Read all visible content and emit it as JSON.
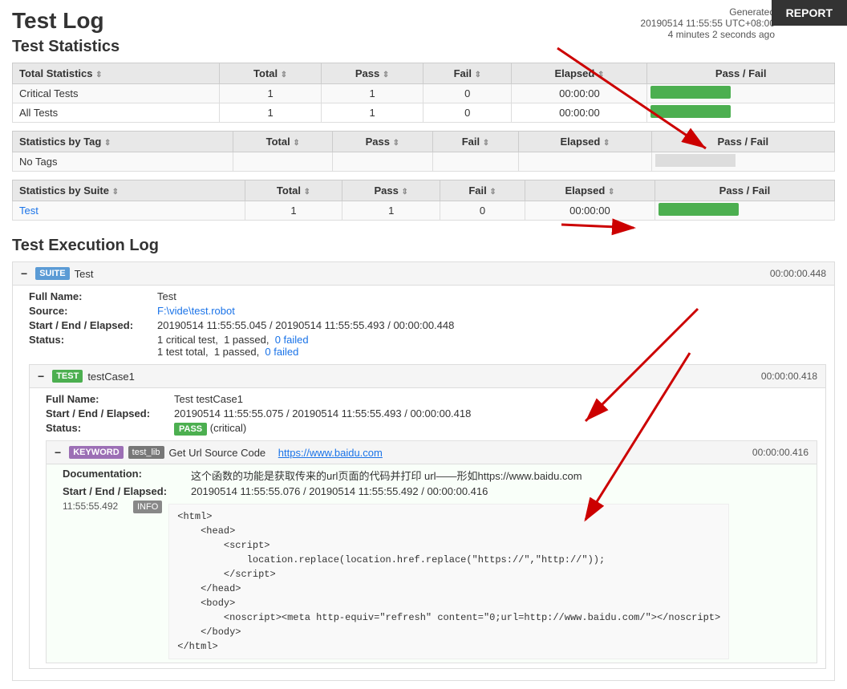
{
  "report_button": "REPORT",
  "page_title": "Test Log",
  "generated": {
    "label": "Generated",
    "datetime": "20190514 11:55:55 UTC+08:00",
    "ago": "4 minutes 2 seconds ago"
  },
  "test_statistics": {
    "heading": "Test Statistics",
    "total_stats": {
      "columns": [
        "Total Statistics",
        "Total",
        "Pass",
        "Fail",
        "Elapsed",
        "Pass / Fail"
      ],
      "rows": [
        {
          "name": "Critical Tests",
          "total": 1,
          "pass": 1,
          "fail": 0,
          "elapsed": "00:00:00",
          "pass_pct": 100
        },
        {
          "name": "All Tests",
          "total": 1,
          "pass": 1,
          "fail": 0,
          "elapsed": "00:00:00",
          "pass_pct": 100
        }
      ]
    },
    "tag_stats": {
      "columns": [
        "Statistics by Tag",
        "Total",
        "Pass",
        "Fail",
        "Elapsed",
        "Pass / Fail"
      ],
      "rows": [
        {
          "name": "No Tags",
          "total": "",
          "pass": "",
          "fail": "",
          "elapsed": "",
          "pass_pct": null
        }
      ]
    },
    "suite_stats": {
      "columns": [
        "Statistics by Suite",
        "Total",
        "Pass",
        "Fail",
        "Elapsed",
        "Pass / Fail"
      ],
      "rows": [
        {
          "name": "Test",
          "total": 1,
          "pass": 1,
          "fail": 0,
          "elapsed": "00:00:00",
          "pass_pct": 100
        }
      ]
    }
  },
  "execution_log": {
    "heading": "Test Execution Log",
    "suite": {
      "collapse": "−",
      "badge": "SUITE",
      "name": "Test",
      "elapsed": "00:00:00.448",
      "full_name_label": "Full Name:",
      "full_name": "Test",
      "source_label": "Source:",
      "source_path": "F:\\vide\\test.robot",
      "start_end_elapsed_label": "Start / End / Elapsed:",
      "start_end_elapsed": "20190514 11:55:55.045 / 20190514 11:55:55.493 / 00:00:00.448",
      "status_label": "Status:",
      "status_line1": "1 critical test,  1 passed,  0 failed",
      "status_line2": "1 test total,  1 passed,  0 failed",
      "test": {
        "collapse": "−",
        "badge": "TEST",
        "name": "testCase1",
        "elapsed": "00:00:00.418",
        "full_name_label": "Full Name:",
        "full_name": "Test testCase1",
        "start_end_elapsed_label": "Start / End / Elapsed:",
        "start_end_elapsed": "20190514 11:55:55.075 / 20190514 11:55:55.493 / 00:00:00.418",
        "status_label": "Status:",
        "status_badge": "PASS",
        "status_extra": "(critical)",
        "keyword": {
          "collapse": "−",
          "badge": "KEYWORD",
          "lib_badge": "test_lib",
          "name": "Get Url Source Code",
          "url": "https://www.baidu.com",
          "elapsed": "00:00:00.416",
          "doc_label": "Documentation:",
          "doc_text": "这个函数的功能是获取传来的url页面的代码并打印 url——形如https://www.baidu.com",
          "start_end_elapsed_label": "Start / End / Elapsed:",
          "start_end_elapsed": "20190514 11:55:55.076 / 20190514 11:55:55.492 / 00:00:00.416",
          "log_timestamp": "11:55:55.492",
          "log_badge": "INFO",
          "log_code": "<html>\n    <head>\n        <script>\n            location.replace(location.href.replace(\"https://\",\"http://\"));\n        </script>\n    </head>\n    <body>\n        <noscript><meta http-equiv=\"refresh\" content=\"0;url=http://www.baidu.com/\"></noscript>\n    </body>\n</html>"
        }
      }
    }
  }
}
